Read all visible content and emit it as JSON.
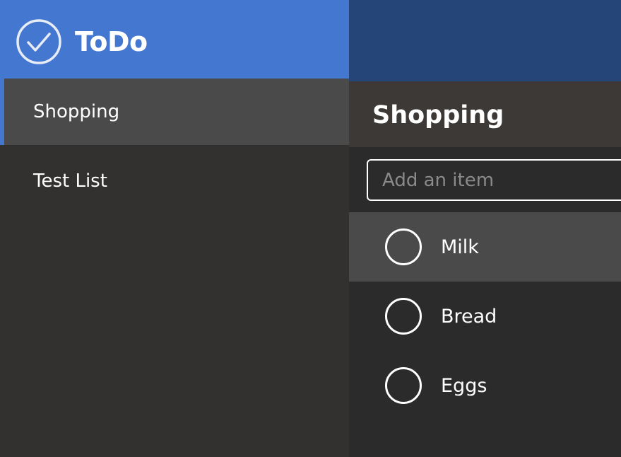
{
  "app": {
    "title": "ToDo",
    "logo_icon": "checkmark-circle-icon",
    "accent_color": "#4477d0"
  },
  "sidebar": {
    "items": [
      {
        "label": "Shopping",
        "selected": true
      },
      {
        "label": "Test List",
        "selected": false
      }
    ]
  },
  "list": {
    "title": "Shopping",
    "add_placeholder": "Add an item",
    "add_value": "",
    "items": [
      {
        "label": "Milk",
        "done": false
      },
      {
        "label": "Bread",
        "done": false
      },
      {
        "label": "Eggs",
        "done": false
      }
    ]
  }
}
